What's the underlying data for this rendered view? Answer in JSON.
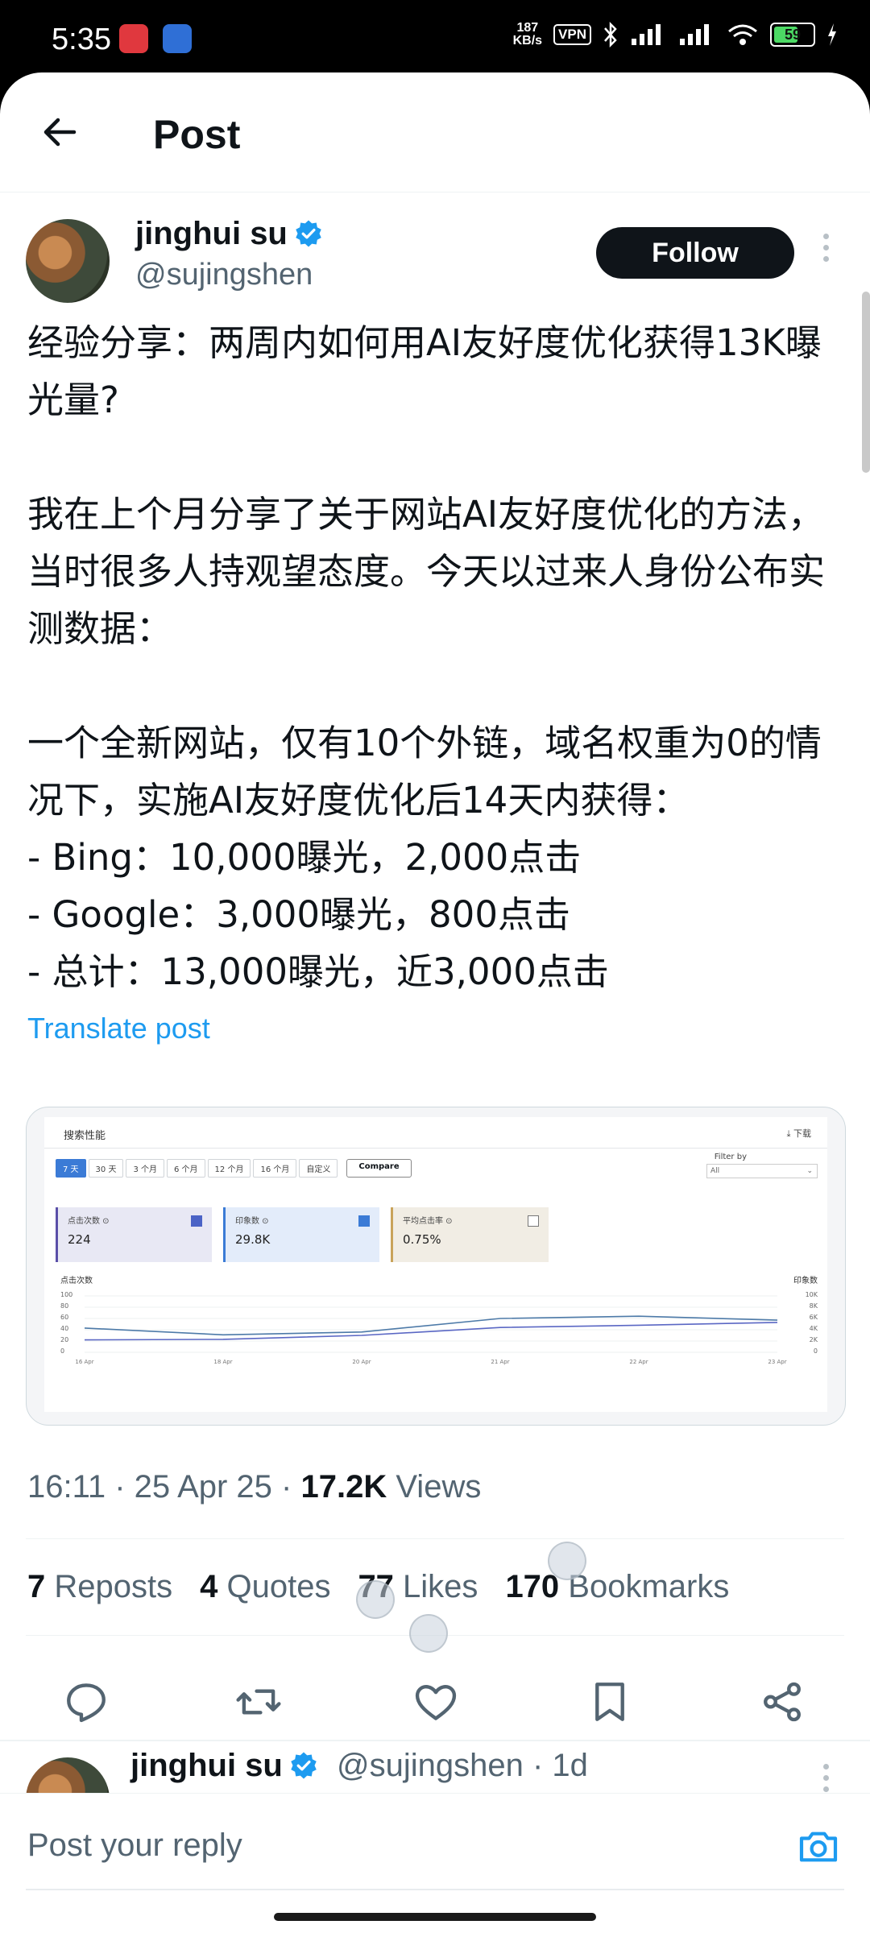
{
  "status_bar": {
    "time": "5:35",
    "speed_value": "187",
    "speed_unit": "KB/s",
    "vpn": "VPN",
    "battery": "59"
  },
  "header": {
    "title": "Post"
  },
  "author": {
    "name": "jinghui su",
    "handle": "@sujingshen",
    "follow_label": "Follow"
  },
  "post": {
    "text": "经验分享：两周内如何用AI友好度优化获得13K曝光量?\n\n我在上个月分享了关于网站AI友好度优化的方法，当时很多人持观望态度。今天以过来人身份公布实测数据：\n\n一个全新网站，仅有10个外链，域名权重为0的情况下，实施AI友好度优化后14天内获得：\n- Bing：10,000曝光，2,000点击\n- Google：3,000曝光，800点击\n- 总计：13,000曝光，近3,000点击",
    "translate_label": "Translate post"
  },
  "media": {
    "title": "搜索性能",
    "download": "下载",
    "tabs": [
      "7 天",
      "30 天",
      "3 个月",
      "6 个月",
      "12 个月",
      "16 个月",
      "自定义"
    ],
    "compare": "Compare",
    "filter_label": "Filter by",
    "filter_value": "All",
    "cards": [
      {
        "label": "点击次数",
        "value": "224"
      },
      {
        "label": "印象数",
        "value": "29.8K"
      },
      {
        "label": "平均点击率",
        "value": "0.75%"
      }
    ],
    "chart_left_title": "点击次数",
    "chart_right_title": "印象数",
    "chart_data": {
      "type": "line",
      "x": [
        "16 Apr",
        "18 Apr",
        "20 Apr",
        "21 Apr",
        "22 Apr",
        "23 Apr"
      ],
      "y_left_ticks": [
        "100",
        "80",
        "60",
        "40",
        "20",
        "0"
      ],
      "y_right_ticks": [
        "10K",
        "8K",
        "6K",
        "4K",
        "2K",
        "0"
      ],
      "ylim_left": [
        0,
        100
      ],
      "ylim_right": [
        0,
        10000
      ],
      "series": [
        {
          "name": "点击次数",
          "color": "#5a67c4",
          "values": [
            22,
            23,
            30,
            44,
            48,
            53
          ]
        },
        {
          "name": "印象数",
          "color": "#4d7aa8",
          "values": [
            4300,
            3100,
            3600,
            6000,
            6400,
            5700
          ]
        }
      ]
    }
  },
  "meta": {
    "time": "16:11 · 25 Apr 25 · ",
    "views_count": "17.2K",
    "views_label": " Views"
  },
  "stats": {
    "reposts_count": "7",
    "reposts_label": " Reposts",
    "quotes_count": "4",
    "quotes_label": " Quotes",
    "likes_count": "77",
    "likes_label": " Likes",
    "bookmarks_count": "170",
    "bookmarks_label": " Bookmarks"
  },
  "reply_preview": {
    "name": "jinghui su",
    "handle": "@sujingshen · 1d"
  },
  "reply_bar": {
    "placeholder": "Post your reply"
  },
  "colors": {
    "accent": "#1d9bf0",
    "verified": "#1d9bf0",
    "follow_bg": "#0f1419"
  }
}
